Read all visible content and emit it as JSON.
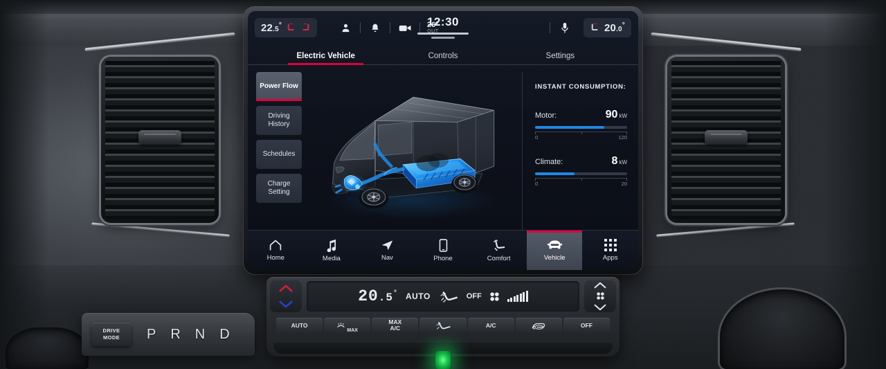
{
  "theme": {
    "accent": "#e0003c",
    "bar": "#1e88e5",
    "screen_bg": "#0b0e16",
    "text": "#e8ecf2"
  },
  "status_bar": {
    "left_temp": {
      "whole": "22",
      "decimal": ".5",
      "degree": "°"
    },
    "left_seat_icons": [
      "seat-heat-left-icon",
      "seat-heat-right-icon"
    ],
    "icons": [
      "profile-icon",
      "notification-bell-icon",
      "camera-icon"
    ],
    "outside_temp": {
      "value": "26°",
      "label": "OUT"
    },
    "clock": "12:30",
    "mic_icon": "microphone-icon",
    "right_temp": {
      "whole": "20",
      "decimal": ".0",
      "degree": "°"
    },
    "right_seat_icon": "seat-heat-passenger-icon"
  },
  "tabs": [
    {
      "label": "Electric Vehicle",
      "active": true
    },
    {
      "label": "Controls",
      "active": false
    },
    {
      "label": "Settings",
      "active": false
    }
  ],
  "sidebar": {
    "items": [
      {
        "label": "Power Flow",
        "active": true
      },
      {
        "label": "Driving History",
        "active": false
      },
      {
        "label": "Schedules",
        "active": false
      },
      {
        "label": "Charge Setting",
        "active": false
      }
    ]
  },
  "vehicle_graphic": {
    "name": "electric-van-xray-illustration",
    "highlights": [
      "battery-pack",
      "electric-motor",
      "power-cables"
    ]
  },
  "consumption": {
    "title": "INSTANT CONSUMPTION:",
    "rows": [
      {
        "label": "Motor:",
        "value": "90",
        "unit": "kW",
        "min": "0",
        "max": "120",
        "percent": 75
      },
      {
        "label": "Climate:",
        "value": "8",
        "unit": "kW",
        "min": "0",
        "max": "20",
        "percent": 43
      }
    ]
  },
  "bottom_nav": [
    {
      "label": "Home",
      "icon": "home-icon",
      "active": false
    },
    {
      "label": "Media",
      "icon": "music-note-icon",
      "active": false
    },
    {
      "label": "Nav",
      "icon": "navigation-arrow-icon",
      "active": false
    },
    {
      "label": "Phone",
      "icon": "phone-icon",
      "active": false
    },
    {
      "label": "Comfort",
      "icon": "comfort-seat-icon",
      "active": false
    },
    {
      "label": "Vehicle",
      "icon": "car-front-icon",
      "active": true
    },
    {
      "label": "Apps",
      "icon": "apps-grid-icon",
      "active": false
    }
  ],
  "climate_panel": {
    "temp": {
      "whole": "20",
      "decimal": ".5",
      "degree": "°"
    },
    "auto_label": "AUTO",
    "airflow_icon": "airflow-direction-icon",
    "off_label": "OFF",
    "fan_icon": "fan-icon",
    "fan_level": 7,
    "fan_level_max": 7,
    "left_rocker": {
      "up": "temp-up-arrow-icon",
      "down": "temp-down-arrow-icon"
    },
    "right_rocker": {
      "up": "fan-up-arrow-icon",
      "fan": "fan-icon",
      "down": "fan-down-arrow-icon"
    },
    "buttons": [
      {
        "label": "AUTO",
        "icon": null
      },
      {
        "label": "MAX",
        "icon": "rear-defrost-icon"
      },
      {
        "label": "MAX\nA/C",
        "icon": null
      },
      {
        "label": "",
        "icon": "airflow-direction-icon"
      },
      {
        "label": "A/C",
        "icon": null
      },
      {
        "label": "",
        "icon": "recirculation-icon"
      },
      {
        "label": "OFF",
        "icon": null
      }
    ]
  },
  "gear_selector": {
    "drive_mode_line1": "DRIVE",
    "drive_mode_line2": "MODE",
    "gears": [
      "P",
      "R",
      "N",
      "D"
    ]
  }
}
